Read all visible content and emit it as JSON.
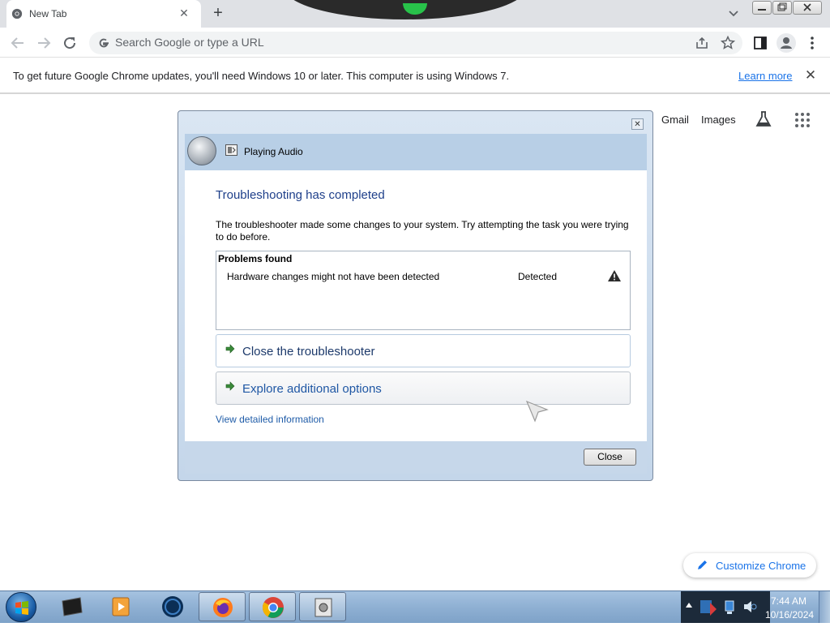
{
  "browser": {
    "tab_title": "New Tab",
    "tab_close_glyph": "✕",
    "new_tab_glyph": "+",
    "omnibox_placeholder": "Search Google or type a URL"
  },
  "infobar": {
    "message": "To get future Google Chrome updates, you'll need Windows 10 or later. This computer is using Windows 7.",
    "learn_more": "Learn more",
    "close_glyph": "✕"
  },
  "ntp": {
    "gmail": "Gmail",
    "images": "Images",
    "customize": "Customize Chrome"
  },
  "dialog": {
    "window_title": "Playing Audio",
    "close_glyph": "✕",
    "heading": "Troubleshooting has completed",
    "description": "The troubleshooter made some changes to your system. Try attempting the task you were trying to do before.",
    "problems_title": "Problems found",
    "problems": [
      {
        "name": "Hardware changes might not have been detected",
        "status": "Detected",
        "icon": "warning-icon"
      }
    ],
    "options": [
      {
        "label": "Close the troubleshooter",
        "icon": "green-arrow-icon"
      },
      {
        "label": "Explore additional options",
        "icon": "green-arrow-icon"
      }
    ],
    "details_link": "View detailed information",
    "close_button": "Close"
  },
  "taskbar": {
    "items": [
      "start-orb",
      "media-center-icon",
      "media-player-icon",
      "globe-icon",
      "firefox-icon",
      "chrome-icon",
      "troubleshooter-icon"
    ],
    "clock_time": "7:44 AM",
    "clock_date": "10/16/2024"
  },
  "colors": {
    "chrome_tabstrip": "#dfe1e5",
    "link_blue": "#1a73e8",
    "dialog_heading": "#1e3f8a",
    "taskbar": "#8fb0d3"
  }
}
